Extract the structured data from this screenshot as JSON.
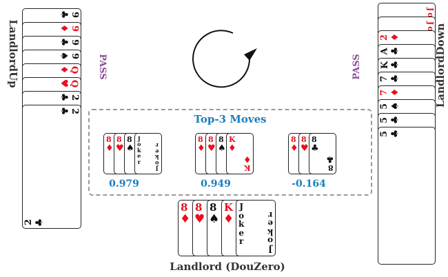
{
  "players": {
    "up": {
      "name": "LandlordUp",
      "status": "PASS",
      "cards": [
        {
          "rank": "9",
          "suit": "♣",
          "color": "black"
        },
        {
          "rank": "9",
          "suit": "♦",
          "color": "red"
        },
        {
          "rank": "9",
          "suit": "♣",
          "color": "black"
        },
        {
          "rank": "9",
          "suit": "♠",
          "color": "black"
        },
        {
          "rank": "Q",
          "suit": "♦",
          "color": "red"
        },
        {
          "rank": "Q",
          "suit": "♥",
          "color": "red"
        },
        {
          "rank": "2",
          "suit": "♣",
          "color": "black"
        },
        {
          "rank": "2",
          "suit": "♣",
          "color": "black"
        }
      ]
    },
    "down": {
      "name": "LandlordDown",
      "status": "PASS",
      "cards": [
        {
          "rank": "Joker",
          "color": "red"
        },
        {
          "rank": "Joker",
          "color": "red"
        },
        {
          "rank": "2",
          "suit": "♦",
          "color": "red"
        },
        {
          "rank": "A",
          "suit": "♣",
          "color": "black"
        },
        {
          "rank": "K",
          "suit": "♣",
          "color": "black"
        },
        {
          "rank": "7",
          "suit": "♣",
          "color": "black"
        },
        {
          "rank": "7",
          "suit": "♦",
          "color": "red"
        },
        {
          "rank": "5",
          "suit": "♠",
          "color": "black"
        },
        {
          "rank": "5",
          "suit": "♣",
          "color": "black"
        },
        {
          "rank": "5",
          "suit": "♣",
          "color": "black"
        }
      ]
    },
    "landlord": {
      "name": "Landlord (DouZero)",
      "cards": [
        {
          "rank": "8",
          "suit": "♦",
          "color": "red"
        },
        {
          "rank": "8",
          "suit": "♥",
          "color": "red"
        },
        {
          "rank": "8",
          "suit": "♠",
          "color": "black"
        },
        {
          "rank": "K",
          "suit": "♦",
          "color": "red"
        },
        {
          "rank": "Joker",
          "color": "black"
        }
      ]
    }
  },
  "top_moves": {
    "title": "Top-3 Moves",
    "moves": [
      {
        "score": "0.979",
        "cards": [
          {
            "rank": "8",
            "suit": "♦",
            "color": "red"
          },
          {
            "rank": "8",
            "suit": "♥",
            "color": "red"
          },
          {
            "rank": "8",
            "suit": "♠",
            "color": "black"
          },
          {
            "rank": "Joker",
            "color": "black"
          }
        ]
      },
      {
        "score": "0.949",
        "cards": [
          {
            "rank": "8",
            "suit": "♦",
            "color": "red"
          },
          {
            "rank": "8",
            "suit": "♥",
            "color": "red"
          },
          {
            "rank": "8",
            "suit": "♠",
            "color": "black"
          },
          {
            "rank": "K",
            "suit": "♦",
            "color": "red"
          }
        ]
      },
      {
        "score": "-0.164",
        "cards": [
          {
            "rank": "8",
            "suit": "♦",
            "color": "red"
          },
          {
            "rank": "8",
            "suit": "♥",
            "color": "red"
          },
          {
            "rank": "8",
            "suit": "♣",
            "color": "black"
          }
        ]
      }
    ]
  },
  "colors": {
    "red": "#e8101e",
    "black": "#111111",
    "accent": "#1a7dbd",
    "pass": "#8a4e97",
    "dashed_border": "#999999"
  },
  "icons": {
    "turn_indicator": "clockwise-arrow-icon"
  }
}
